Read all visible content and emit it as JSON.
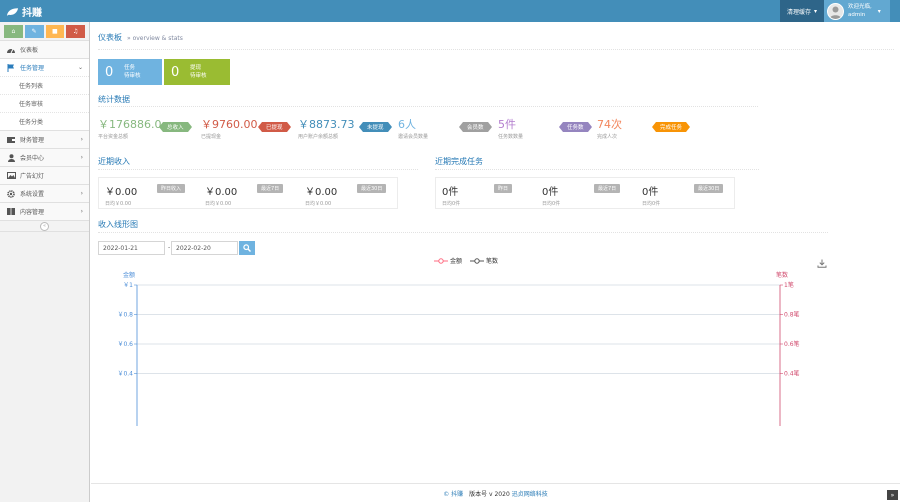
{
  "header": {
    "logo_text": "抖赚",
    "clear_cache": "清理缓存",
    "welcome": "欢迎光临,",
    "username": "admin",
    "bg_color": "#438eb9"
  },
  "sidebar": {
    "shortcut_colors": [
      "#87b87f",
      "#6fb3e0",
      "#ffb752",
      "#d15b47"
    ],
    "shortcut_icons": [
      "home-icon",
      "pencil-icon",
      "users-icon",
      "bell-icon"
    ],
    "items": [
      {
        "label": "仪表板",
        "icon": "dashboard-icon"
      },
      {
        "label": "任务管理",
        "icon": "flag-icon"
      },
      {
        "label": "财务管理",
        "icon": "wallet-icon"
      },
      {
        "label": "会员中心",
        "icon": "user-icon"
      },
      {
        "label": "广告幻灯",
        "icon": "image-icon"
      },
      {
        "label": "系统设置",
        "icon": "cog-icon"
      },
      {
        "label": "内容管理",
        "icon": "book-icon"
      }
    ],
    "subitems": [
      "任务列表",
      "任务审核",
      "任务分类"
    ]
  },
  "breadcrumb": {
    "title": "仪表板",
    "sub": "» overview & stats"
  },
  "infoboxes": [
    {
      "num": "0",
      "line1": "任务",
      "line2": "待审核",
      "color": "#6fb3e0"
    },
    {
      "num": "0",
      "line1": "提现",
      "line2": "待审核",
      "color": "#9abc32"
    }
  ],
  "stats_title": "统计数据",
  "stats": [
    {
      "value": "￥176886.0",
      "label": "平台资金总额",
      "tag": "总收入",
      "color": "#87b87f",
      "val_color": "#87b87f"
    },
    {
      "value": "￥9760.00",
      "label": "已提现金",
      "tag": "已提现",
      "color": "#d15b47",
      "val_color": "#d15b47"
    },
    {
      "value": "￥8873.73",
      "label": "用户账户余额总额",
      "tag": "未提现",
      "color": "#438eb9",
      "val_color": "#438eb9"
    },
    {
      "value": "6人",
      "label": "邀请会员数量",
      "tag": "会员数",
      "color": "#a0a0a0",
      "val_color": "#6fb3e0"
    },
    {
      "value": "5件",
      "label": "任务数数量",
      "tag": "任务数",
      "color": "#9585bf",
      "val_color": "#b37dce"
    },
    {
      "value": "74次",
      "label": "完成人次",
      "tag": "完成任务",
      "color": "#f89406",
      "val_color": "#f2865c"
    }
  ],
  "income_title": "近期收入",
  "income": [
    {
      "value": "￥0.00",
      "label": "日均￥0.00",
      "tag": "昨日收入"
    },
    {
      "value": "￥0.00",
      "label": "日均￥0.00",
      "tag": "最近7日"
    },
    {
      "value": "￥0.00",
      "label": "日均￥0.00",
      "tag": "最近30日"
    }
  ],
  "tasks_title": "近期完成任务",
  "tasks": [
    {
      "value": "0件",
      "label": "日均0件",
      "tag": "昨日"
    },
    {
      "value": "0件",
      "label": "日均0件",
      "tag": "最近7日"
    },
    {
      "value": "0件",
      "label": "日均0件",
      "tag": "最近30日"
    }
  ],
  "chart_title": "收入线形图",
  "date_from": "2022-01-21",
  "date_to": "2022-02-20",
  "date_sep": "-",
  "chart_data": {
    "type": "line",
    "series": [
      {
        "name": "金额",
        "color": "#ff6b81",
        "values": []
      },
      {
        "name": "笔数",
        "color": "#555555",
        "values": []
      }
    ],
    "y_left": {
      "label": "金额",
      "ticks": [
        "￥1",
        "￥0.8",
        "￥0.6",
        "￥0.4"
      ],
      "color": "#4e8fd8"
    },
    "y_right": {
      "label": "笔数",
      "ticks": [
        "1笔",
        "0.8笔",
        "0.6笔",
        "0.4笔"
      ],
      "color": "#d14b6e"
    },
    "ylim": [
      0.4,
      1
    ],
    "grid": true,
    "legend": "top-center"
  },
  "footer": {
    "brand": "© 抖赚",
    "version": "版本号 v 2020",
    "company": "迅贞网络科技"
  }
}
